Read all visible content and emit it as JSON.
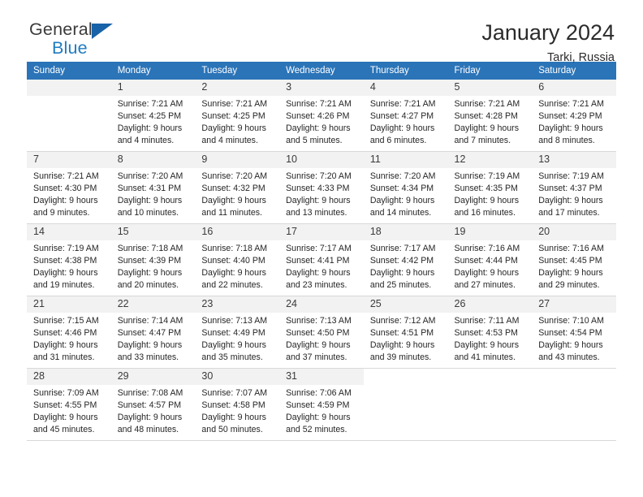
{
  "brand": {
    "name_top": "General",
    "name_bottom": "Blue",
    "triangle_color": "#1862a8",
    "blue_text_color": "#1f7bc1"
  },
  "header": {
    "month_title": "January 2024",
    "location": "Tarki, Russia"
  },
  "theme": {
    "header_row_bg": "#2b74b8",
    "daynum_bg": "#f2f2f2",
    "grid_line": "#d8d8d8"
  },
  "calendar": {
    "weekday_headers": [
      "Sunday",
      "Monday",
      "Tuesday",
      "Wednesday",
      "Thursday",
      "Friday",
      "Saturday"
    ],
    "weeks": [
      [
        {
          "day": "",
          "empty": true
        },
        {
          "day": "1",
          "sunrise": "Sunrise: 7:21 AM",
          "sunset": "Sunset: 4:25 PM",
          "daylight": "Daylight: 9 hours and 4 minutes."
        },
        {
          "day": "2",
          "sunrise": "Sunrise: 7:21 AM",
          "sunset": "Sunset: 4:25 PM",
          "daylight": "Daylight: 9 hours and 4 minutes."
        },
        {
          "day": "3",
          "sunrise": "Sunrise: 7:21 AM",
          "sunset": "Sunset: 4:26 PM",
          "daylight": "Daylight: 9 hours and 5 minutes."
        },
        {
          "day": "4",
          "sunrise": "Sunrise: 7:21 AM",
          "sunset": "Sunset: 4:27 PM",
          "daylight": "Daylight: 9 hours and 6 minutes."
        },
        {
          "day": "5",
          "sunrise": "Sunrise: 7:21 AM",
          "sunset": "Sunset: 4:28 PM",
          "daylight": "Daylight: 9 hours and 7 minutes."
        },
        {
          "day": "6",
          "sunrise": "Sunrise: 7:21 AM",
          "sunset": "Sunset: 4:29 PM",
          "daylight": "Daylight: 9 hours and 8 minutes."
        }
      ],
      [
        {
          "day": "7",
          "sunrise": "Sunrise: 7:21 AM",
          "sunset": "Sunset: 4:30 PM",
          "daylight": "Daylight: 9 hours and 9 minutes."
        },
        {
          "day": "8",
          "sunrise": "Sunrise: 7:20 AM",
          "sunset": "Sunset: 4:31 PM",
          "daylight": "Daylight: 9 hours and 10 minutes."
        },
        {
          "day": "9",
          "sunrise": "Sunrise: 7:20 AM",
          "sunset": "Sunset: 4:32 PM",
          "daylight": "Daylight: 9 hours and 11 minutes."
        },
        {
          "day": "10",
          "sunrise": "Sunrise: 7:20 AM",
          "sunset": "Sunset: 4:33 PM",
          "daylight": "Daylight: 9 hours and 13 minutes."
        },
        {
          "day": "11",
          "sunrise": "Sunrise: 7:20 AM",
          "sunset": "Sunset: 4:34 PM",
          "daylight": "Daylight: 9 hours and 14 minutes."
        },
        {
          "day": "12",
          "sunrise": "Sunrise: 7:19 AM",
          "sunset": "Sunset: 4:35 PM",
          "daylight": "Daylight: 9 hours and 16 minutes."
        },
        {
          "day": "13",
          "sunrise": "Sunrise: 7:19 AM",
          "sunset": "Sunset: 4:37 PM",
          "daylight": "Daylight: 9 hours and 17 minutes."
        }
      ],
      [
        {
          "day": "14",
          "sunrise": "Sunrise: 7:19 AM",
          "sunset": "Sunset: 4:38 PM",
          "daylight": "Daylight: 9 hours and 19 minutes."
        },
        {
          "day": "15",
          "sunrise": "Sunrise: 7:18 AM",
          "sunset": "Sunset: 4:39 PM",
          "daylight": "Daylight: 9 hours and 20 minutes."
        },
        {
          "day": "16",
          "sunrise": "Sunrise: 7:18 AM",
          "sunset": "Sunset: 4:40 PM",
          "daylight": "Daylight: 9 hours and 22 minutes."
        },
        {
          "day": "17",
          "sunrise": "Sunrise: 7:17 AM",
          "sunset": "Sunset: 4:41 PM",
          "daylight": "Daylight: 9 hours and 23 minutes."
        },
        {
          "day": "18",
          "sunrise": "Sunrise: 7:17 AM",
          "sunset": "Sunset: 4:42 PM",
          "daylight": "Daylight: 9 hours and 25 minutes."
        },
        {
          "day": "19",
          "sunrise": "Sunrise: 7:16 AM",
          "sunset": "Sunset: 4:44 PM",
          "daylight": "Daylight: 9 hours and 27 minutes."
        },
        {
          "day": "20",
          "sunrise": "Sunrise: 7:16 AM",
          "sunset": "Sunset: 4:45 PM",
          "daylight": "Daylight: 9 hours and 29 minutes."
        }
      ],
      [
        {
          "day": "21",
          "sunrise": "Sunrise: 7:15 AM",
          "sunset": "Sunset: 4:46 PM",
          "daylight": "Daylight: 9 hours and 31 minutes."
        },
        {
          "day": "22",
          "sunrise": "Sunrise: 7:14 AM",
          "sunset": "Sunset: 4:47 PM",
          "daylight": "Daylight: 9 hours and 33 minutes."
        },
        {
          "day": "23",
          "sunrise": "Sunrise: 7:13 AM",
          "sunset": "Sunset: 4:49 PM",
          "daylight": "Daylight: 9 hours and 35 minutes."
        },
        {
          "day": "24",
          "sunrise": "Sunrise: 7:13 AM",
          "sunset": "Sunset: 4:50 PM",
          "daylight": "Daylight: 9 hours and 37 minutes."
        },
        {
          "day": "25",
          "sunrise": "Sunrise: 7:12 AM",
          "sunset": "Sunset: 4:51 PM",
          "daylight": "Daylight: 9 hours and 39 minutes."
        },
        {
          "day": "26",
          "sunrise": "Sunrise: 7:11 AM",
          "sunset": "Sunset: 4:53 PM",
          "daylight": "Daylight: 9 hours and 41 minutes."
        },
        {
          "day": "27",
          "sunrise": "Sunrise: 7:10 AM",
          "sunset": "Sunset: 4:54 PM",
          "daylight": "Daylight: 9 hours and 43 minutes."
        }
      ],
      [
        {
          "day": "28",
          "sunrise": "Sunrise: 7:09 AM",
          "sunset": "Sunset: 4:55 PM",
          "daylight": "Daylight: 9 hours and 45 minutes."
        },
        {
          "day": "29",
          "sunrise": "Sunrise: 7:08 AM",
          "sunset": "Sunset: 4:57 PM",
          "daylight": "Daylight: 9 hours and 48 minutes."
        },
        {
          "day": "30",
          "sunrise": "Sunrise: 7:07 AM",
          "sunset": "Sunset: 4:58 PM",
          "daylight": "Daylight: 9 hours and 50 minutes."
        },
        {
          "day": "31",
          "sunrise": "Sunrise: 7:06 AM",
          "sunset": "Sunset: 4:59 PM",
          "daylight": "Daylight: 9 hours and 52 minutes."
        },
        {
          "day": "",
          "empty": true,
          "blank": true
        },
        {
          "day": "",
          "empty": true,
          "blank": true
        },
        {
          "day": "",
          "empty": true,
          "blank": true
        }
      ]
    ]
  }
}
